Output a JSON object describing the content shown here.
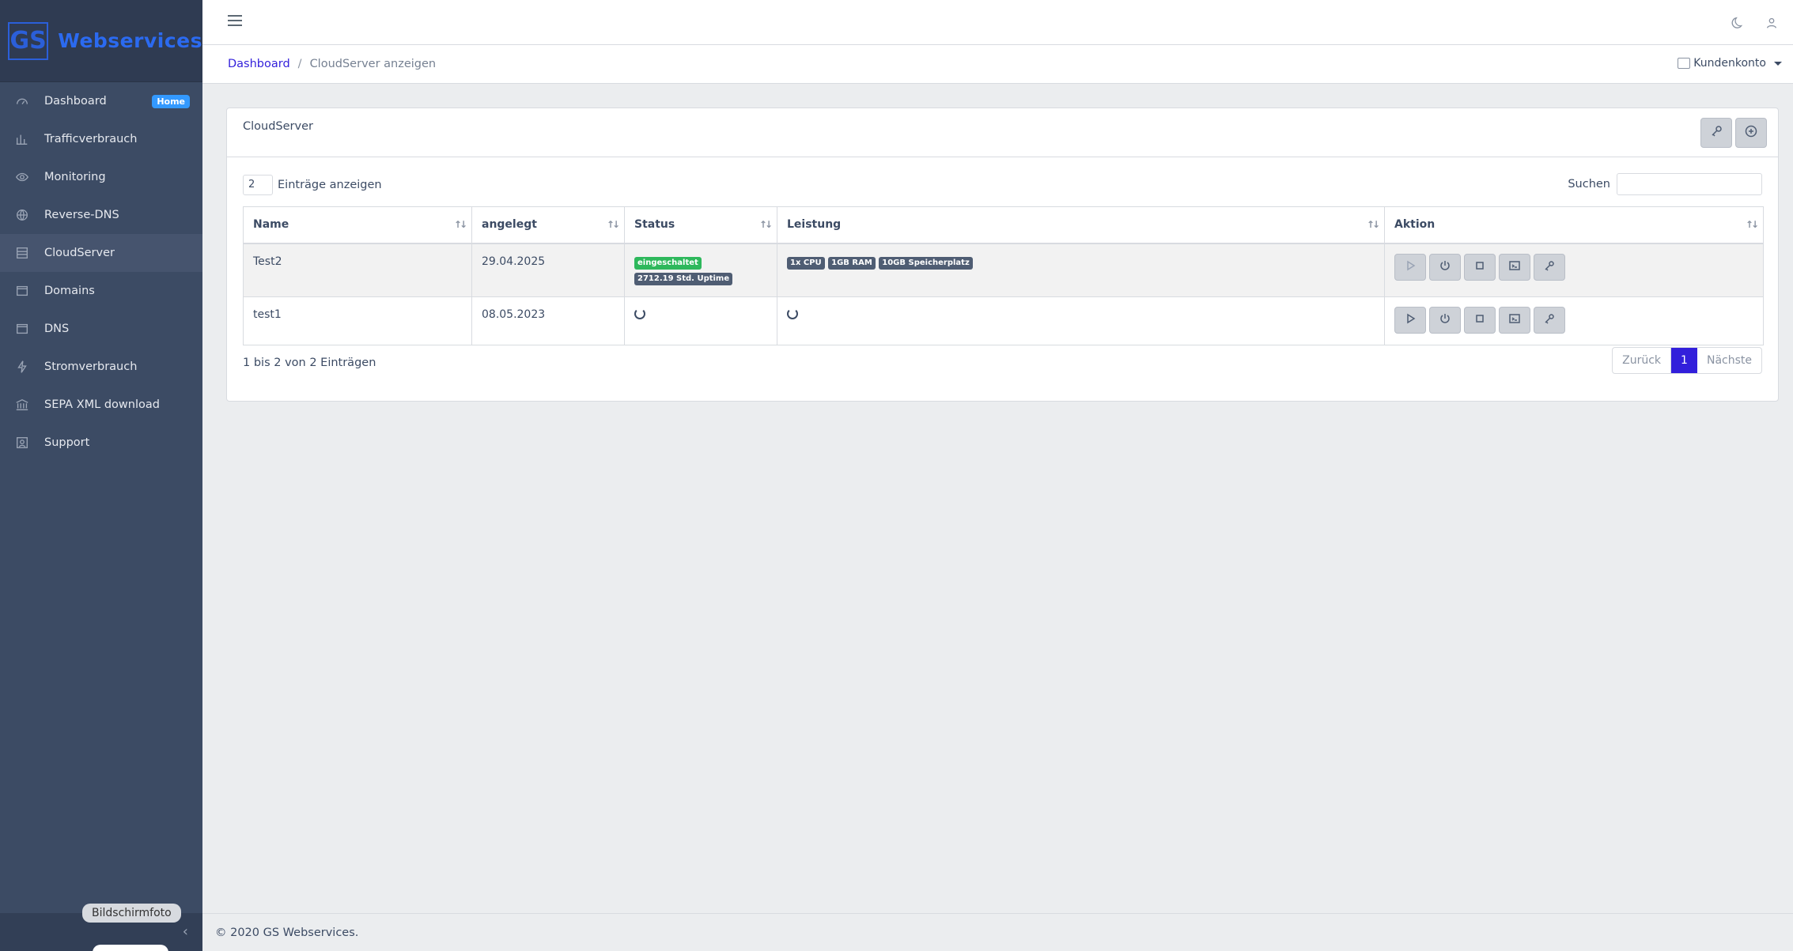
{
  "brand": {
    "logo_text": "GS",
    "name": "Webservices"
  },
  "sidebar": {
    "items": [
      {
        "label": "Dashboard",
        "icon": "speedometer-icon",
        "badge": "Home"
      },
      {
        "label": "Trafficverbrauch",
        "icon": "chart-icon"
      },
      {
        "label": "Monitoring",
        "icon": "eye-icon"
      },
      {
        "label": "Reverse-DNS",
        "icon": "globe-icon"
      },
      {
        "label": "CloudServer",
        "icon": "server-icon",
        "active": true
      },
      {
        "label": "Domains",
        "icon": "browser-icon"
      },
      {
        "label": "DNS",
        "icon": "browser-icon"
      },
      {
        "label": "Stromverbrauch",
        "icon": "bolt-icon"
      },
      {
        "label": "SEPA XML download",
        "icon": "bank-icon"
      },
      {
        "label": "Support",
        "icon": "contact-icon"
      }
    ],
    "tooltip": "Bildschirmfoto"
  },
  "header": {
    "breadcrumb": {
      "home": "Dashboard",
      "separator": "/",
      "current": "CloudServer anzeigen"
    },
    "account": "Kundenkonto"
  },
  "card": {
    "title": "CloudServer",
    "entries_value": "2",
    "entries_label": "Einträge anzeigen",
    "search_label": "Suchen",
    "columns": [
      "Name",
      "angelegt",
      "Status",
      "Leistung",
      "Aktion"
    ],
    "rows": [
      {
        "name": "Test2",
        "created": "29.04.2025",
        "status": "eingeschaltet",
        "uptime": "2712.19 Std. Uptime",
        "cpu": "1x CPU",
        "ram": "1GB RAM",
        "storage": "10GB Speicherplatz"
      },
      {
        "name": "test1",
        "created": "08.05.2023"
      }
    ],
    "info": "1 bis 2 von 2 Einträgen",
    "pager": {
      "prev": "Zurück",
      "current": "1",
      "next": "Nächste"
    }
  },
  "footer": {
    "text": "© 2020 GS Webservices."
  },
  "colors": {
    "sidebar": "#3c4b64",
    "primary": "#321fdb",
    "success": "#2eb85c",
    "badge": "#3399ff"
  }
}
